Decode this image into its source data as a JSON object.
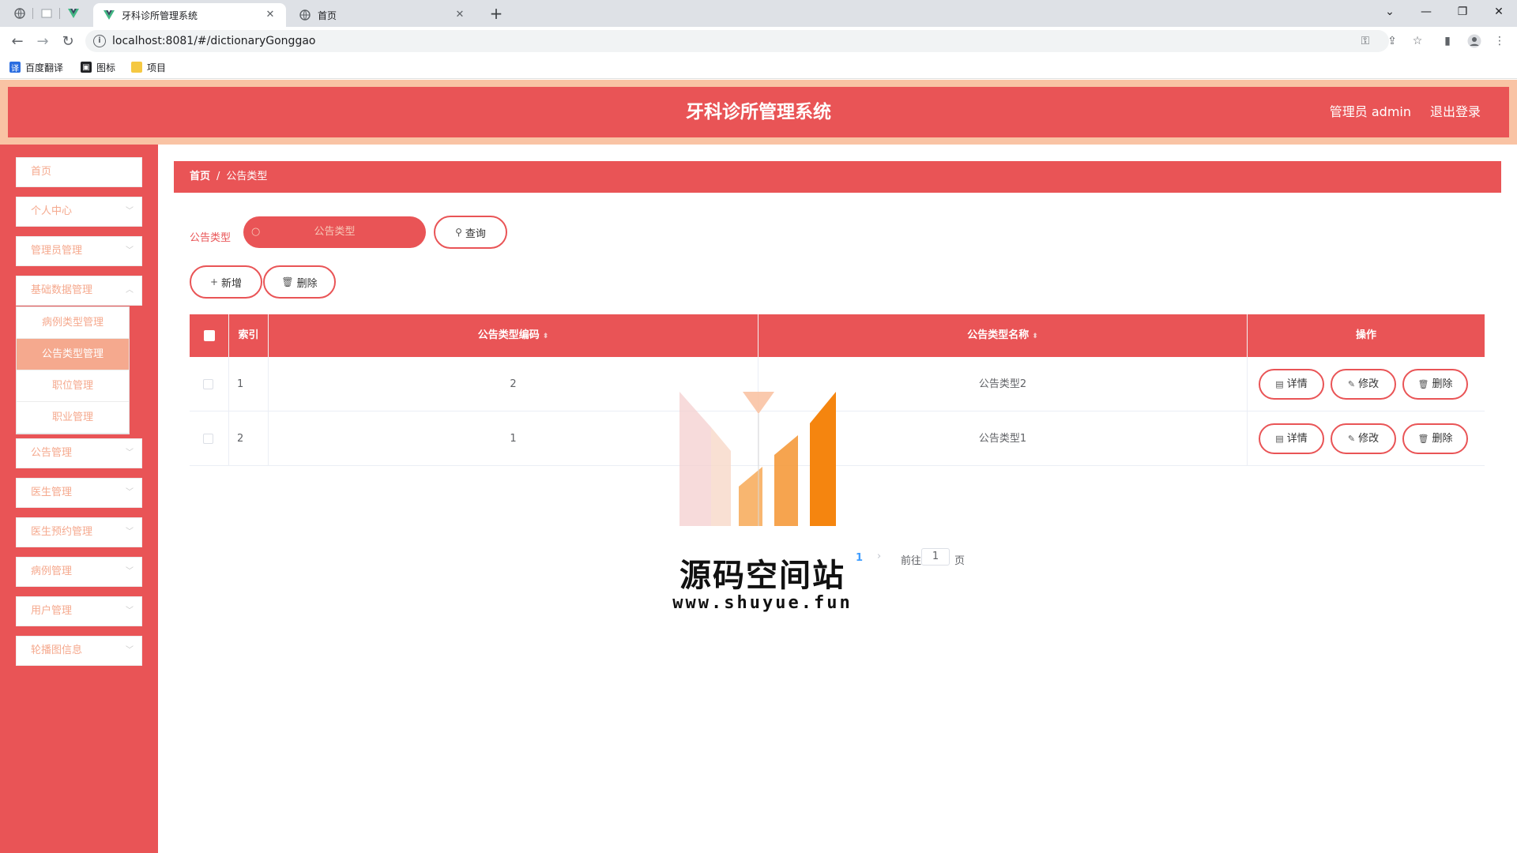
{
  "browser": {
    "tabs": [
      {
        "title": "牙科诊所管理系统",
        "active": true
      },
      {
        "title": "首页",
        "active": false
      }
    ],
    "url": "localhost:8081/#/dictionaryGonggao",
    "bookmarks": [
      {
        "label": "百度翻译",
        "icon": "translate-icon"
      },
      {
        "label": "图标",
        "icon": "image-icon"
      },
      {
        "label": "项目",
        "icon": "folder-icon"
      }
    ]
  },
  "header": {
    "title": "牙科诊所管理系统",
    "user": "管理员 admin",
    "logout": "退出登录"
  },
  "sidebar": {
    "items": [
      {
        "label": "首页"
      },
      {
        "label": "个人中心"
      },
      {
        "label": "管理员管理"
      },
      {
        "label": "基础数据管理"
      },
      {
        "label": "公告管理"
      },
      {
        "label": "医生管理"
      },
      {
        "label": "医生预约管理"
      },
      {
        "label": "病例管理"
      },
      {
        "label": "用户管理"
      },
      {
        "label": "轮播图信息"
      }
    ],
    "submenu": [
      {
        "label": "病例类型管理",
        "active": false
      },
      {
        "label": "公告类型管理",
        "active": true
      },
      {
        "label": "职位管理",
        "active": false
      },
      {
        "label": "职业管理",
        "active": false
      }
    ]
  },
  "breadcrumb": {
    "home": "首页",
    "separator": "/",
    "current": "公告类型"
  },
  "search": {
    "label": "公告类型",
    "placeholder": "公告类型",
    "button": "查询"
  },
  "actions": {
    "add": "新增",
    "delete": "删除"
  },
  "table": {
    "headers": {
      "index": "索引",
      "code": "公告类型编码",
      "name": "公告类型名称",
      "ops": "操作"
    },
    "rows": [
      {
        "index": "1",
        "code": "2",
        "name": "公告类型2"
      },
      {
        "index": "2",
        "code": "1",
        "name": "公告类型1"
      }
    ],
    "row_actions": {
      "detail": "详情",
      "edit": "修改",
      "delete": "删除"
    }
  },
  "pagination": {
    "current": "1",
    "goto_label": "前往",
    "goto_value": "1",
    "unit": "页"
  },
  "watermark": {
    "text": "源码空间站",
    "url": "www.shuyue.fun"
  },
  "colors": {
    "primary": "#e95456",
    "accent": "#f5a98e",
    "header_band": "#f9c3a4"
  }
}
